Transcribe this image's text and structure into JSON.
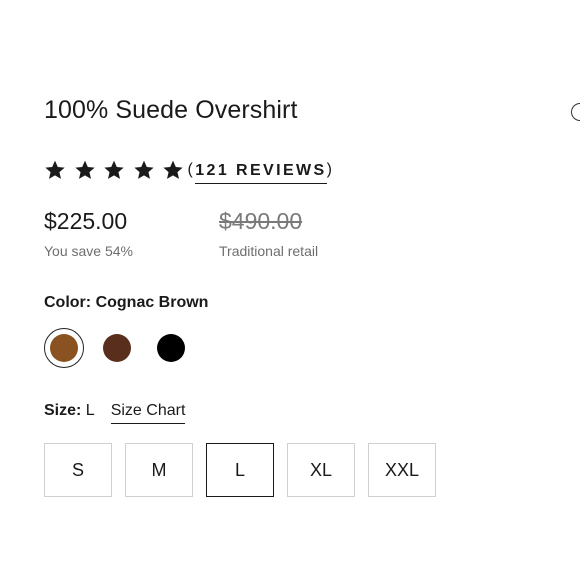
{
  "product": {
    "title": "100% Suede Overshirt"
  },
  "rating": {
    "stars": 5,
    "max_stars": 5,
    "reviews_count": "121",
    "reviews_word": "REVIEWS",
    "star_icon": "star-icon"
  },
  "pricing": {
    "sale_price": "$225.00",
    "savings_text": "You save 54%",
    "retail_price": "$490.00",
    "retail_note": "Traditional retail"
  },
  "color": {
    "label": "Color:",
    "selected_name": "Cognac Brown",
    "swatches": [
      {
        "name": "Cognac Brown",
        "hex": "#8a5220",
        "selected": true
      },
      {
        "name": "Dark Brown",
        "hex": "#5a2e1c",
        "selected": false
      },
      {
        "name": "Black",
        "hex": "#000000",
        "selected": false
      }
    ]
  },
  "size": {
    "label": "Size:",
    "selected": "L",
    "chart_link": "Size Chart",
    "options": [
      "S",
      "M",
      "L",
      "XL",
      "XXL"
    ]
  },
  "icons": {
    "wishlist": "heart-icon"
  }
}
